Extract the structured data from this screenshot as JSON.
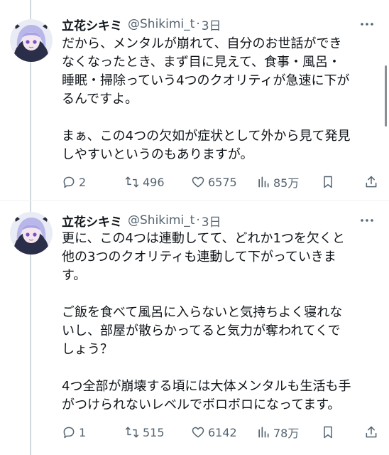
{
  "colors": {
    "text": "#0f1419",
    "secondary": "#536471",
    "thread_line": "#cfd9de"
  },
  "tweets": [
    {
      "name": "立花シキミ",
      "handle": "@Shikimi_t",
      "separator": "·",
      "time": "3日",
      "lines": [
        "だから、メンタルが崩れて、自分のお世話ができ",
        "なくなったとき、まず目に見えて、食事・風呂・",
        "睡眠・掃除っていう4つのクオリティが急速に下が",
        "るんですよ。",
        "",
        "まぁ、この4つの欠如が症状として外から見て発見",
        "しやすいというのもありますが。"
      ],
      "replies": "2",
      "retweets": "496",
      "likes": "6575",
      "views": "85万"
    },
    {
      "name": "立花シキミ",
      "handle": "@Shikimi_t",
      "separator": "·",
      "time": "3日",
      "lines": [
        "更に、この4つは連動してて、どれか1つを欠くと",
        "他の3つのクオリティも連動して下がっていきま",
        "す。",
        "",
        "ご飯を食べて風呂に入らないと気持ちよく寝れな",
        "いし、部屋が散らかってると気力が奪われてくで",
        "しょう？",
        "",
        "4つ全部が崩壊する頃には大体メンタルも生活も手",
        "がつけられないレベルでボロボロになってます。"
      ],
      "replies": "1",
      "retweets": "515",
      "likes": "6142",
      "views": "78万"
    }
  ]
}
